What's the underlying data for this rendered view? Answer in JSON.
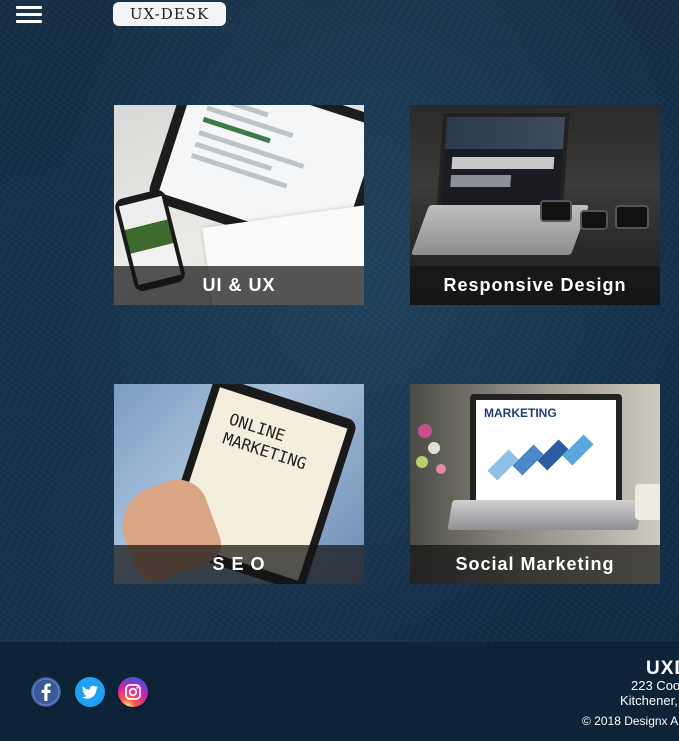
{
  "header": {
    "menu_icon": "hamburger-menu-icon",
    "logo_text": "UX-DESK"
  },
  "cards": [
    {
      "label": "UI & UX"
    },
    {
      "label": "Responsive Design"
    },
    {
      "label": "S E O"
    },
    {
      "label": "Social Marketing"
    }
  ],
  "photos": {
    "seo_screen_text": "ONLINE MARKETING",
    "social_screen_text": "MARKETING"
  },
  "footer": {
    "social": [
      {
        "name": "facebook-icon",
        "color": "#3b5998"
      },
      {
        "name": "twitter-icon",
        "color": "#1da1f2"
      },
      {
        "name": "instagram-icon",
        "color": "#d6249f"
      }
    ],
    "company": "UXD",
    "address_line1": "223 Coo",
    "address_line2": "Kitchener, O",
    "copyright": "© 2018 Designx A"
  },
  "colors": {
    "background": "#12304a",
    "caption_bg": "#141414",
    "footer_bg": "#0d2438"
  }
}
